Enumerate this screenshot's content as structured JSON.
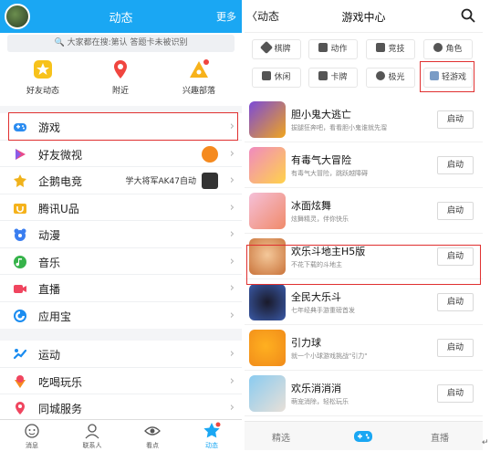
{
  "left": {
    "header": {
      "title": "动态",
      "more": "更多"
    },
    "search": {
      "placeholder": "大家都在搜:第认 答题卡未被识别"
    },
    "quick": [
      {
        "label": "好友动态",
        "icon": "star-badge-icon"
      },
      {
        "label": "附近",
        "icon": "location-pin-icon"
      },
      {
        "label": "兴趣部落",
        "icon": "tribe-icon"
      }
    ],
    "group1": [
      {
        "label": "游戏",
        "icon": "gamepad-icon",
        "extra": ""
      },
      {
        "label": "好友微视",
        "icon": "weishi-play-icon",
        "extra": ""
      },
      {
        "label": "企鹅电竞",
        "icon": "esports-icon",
        "extra": "学大将军AK47自动"
      },
      {
        "label": "腾讯U品",
        "icon": "u-product-icon",
        "extra": ""
      },
      {
        "label": "动漫",
        "icon": "anime-icon",
        "extra": ""
      },
      {
        "label": "音乐",
        "icon": "music-icon",
        "extra": ""
      },
      {
        "label": "直播",
        "icon": "live-camera-icon",
        "extra": ""
      },
      {
        "label": "应用宝",
        "icon": "app-store-icon",
        "extra": ""
      }
    ],
    "group2": [
      {
        "label": "运动",
        "icon": "sports-icon",
        "extra": ""
      },
      {
        "label": "吃喝玩乐",
        "icon": "food-icon",
        "extra": ""
      },
      {
        "label": "同城服务",
        "icon": "city-service-icon",
        "extra": ""
      }
    ],
    "tabbar": [
      {
        "label": "消息",
        "icon": "message-icon"
      },
      {
        "label": "联系人",
        "icon": "contacts-icon"
      },
      {
        "label": "看点",
        "icon": "eye-icon"
      },
      {
        "label": "动态",
        "icon": "star-icon"
      }
    ]
  },
  "right": {
    "header": {
      "back": "动态",
      "title": "游戏中心"
    },
    "categories": [
      {
        "label": "棋牌"
      },
      {
        "label": "动作"
      },
      {
        "label": "竞技"
      },
      {
        "label": "角色"
      },
      {
        "label": "休闲"
      },
      {
        "label": "卡牌"
      },
      {
        "label": "极光"
      },
      {
        "label": "轻游戏"
      }
    ],
    "games": [
      {
        "name": "胆小鬼大逃亡",
        "desc": "拔腿狂奔吧，看看胆小鬼谁就先溜",
        "button": "启动"
      },
      {
        "name": "有毒气大冒险",
        "desc": "有毒气大冒险，跳跃越障碍",
        "button": "启动"
      },
      {
        "name": "冰面炫舞",
        "desc": "炫舞精灵，伴你快乐",
        "button": "启动"
      },
      {
        "name": "欢乐斗地主H5版",
        "desc": "不花下载的斗地主",
        "button": "启动"
      },
      {
        "name": "全民大乐斗",
        "desc": "七年经典手游重磅首发",
        "button": "启动"
      },
      {
        "name": "引力球",
        "desc": "就一个小球游戏挑战\"引力\"",
        "button": "启动"
      },
      {
        "name": "欢乐消消消",
        "desc": "萌宠消除，轻松玩乐",
        "button": "启动"
      }
    ],
    "tabbar": {
      "left": "精选",
      "right": "直播"
    }
  },
  "colors": {
    "brand": "#1aa7f3",
    "highlight": "#e03030"
  }
}
